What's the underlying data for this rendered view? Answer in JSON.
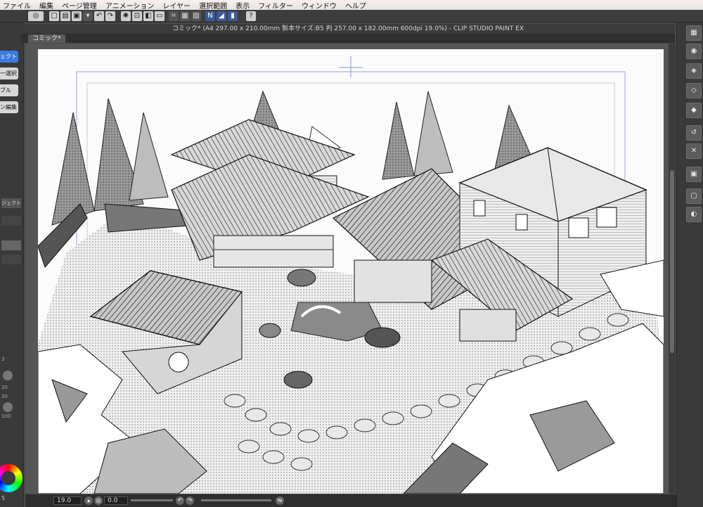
{
  "menu": [
    "ファイル",
    "編集",
    "ページ管理",
    "アニメーション",
    "レイヤー",
    "選択範囲",
    "表示",
    "フィルター",
    "ウィンドウ",
    "ヘルプ"
  ],
  "window": {
    "title": "コミック* (A4 297.00 x 210.00mm 製本サイズ:B5 判 257.00 x 182.00mm 600dpi 19.0%)  - CLIP STUDIO PAINT EX",
    "tab": "コミック*"
  },
  "left_panel": {
    "tabs": [
      "ェクト",
      "一選択",
      "ブル",
      "ン編集"
    ],
    "layer_row": "ジェクト]",
    "brush_sizes": [
      "3",
      "20",
      "30",
      "100"
    ]
  },
  "status": {
    "zoom": "19.0",
    "rotation": "0.0",
    "left_value": "5"
  },
  "toolbar": {
    "help_icon": "?"
  },
  "colors": {
    "accent": "#3d7be0",
    "ui_dark": "#3a3a3a",
    "paper": "#fbfbfb"
  }
}
